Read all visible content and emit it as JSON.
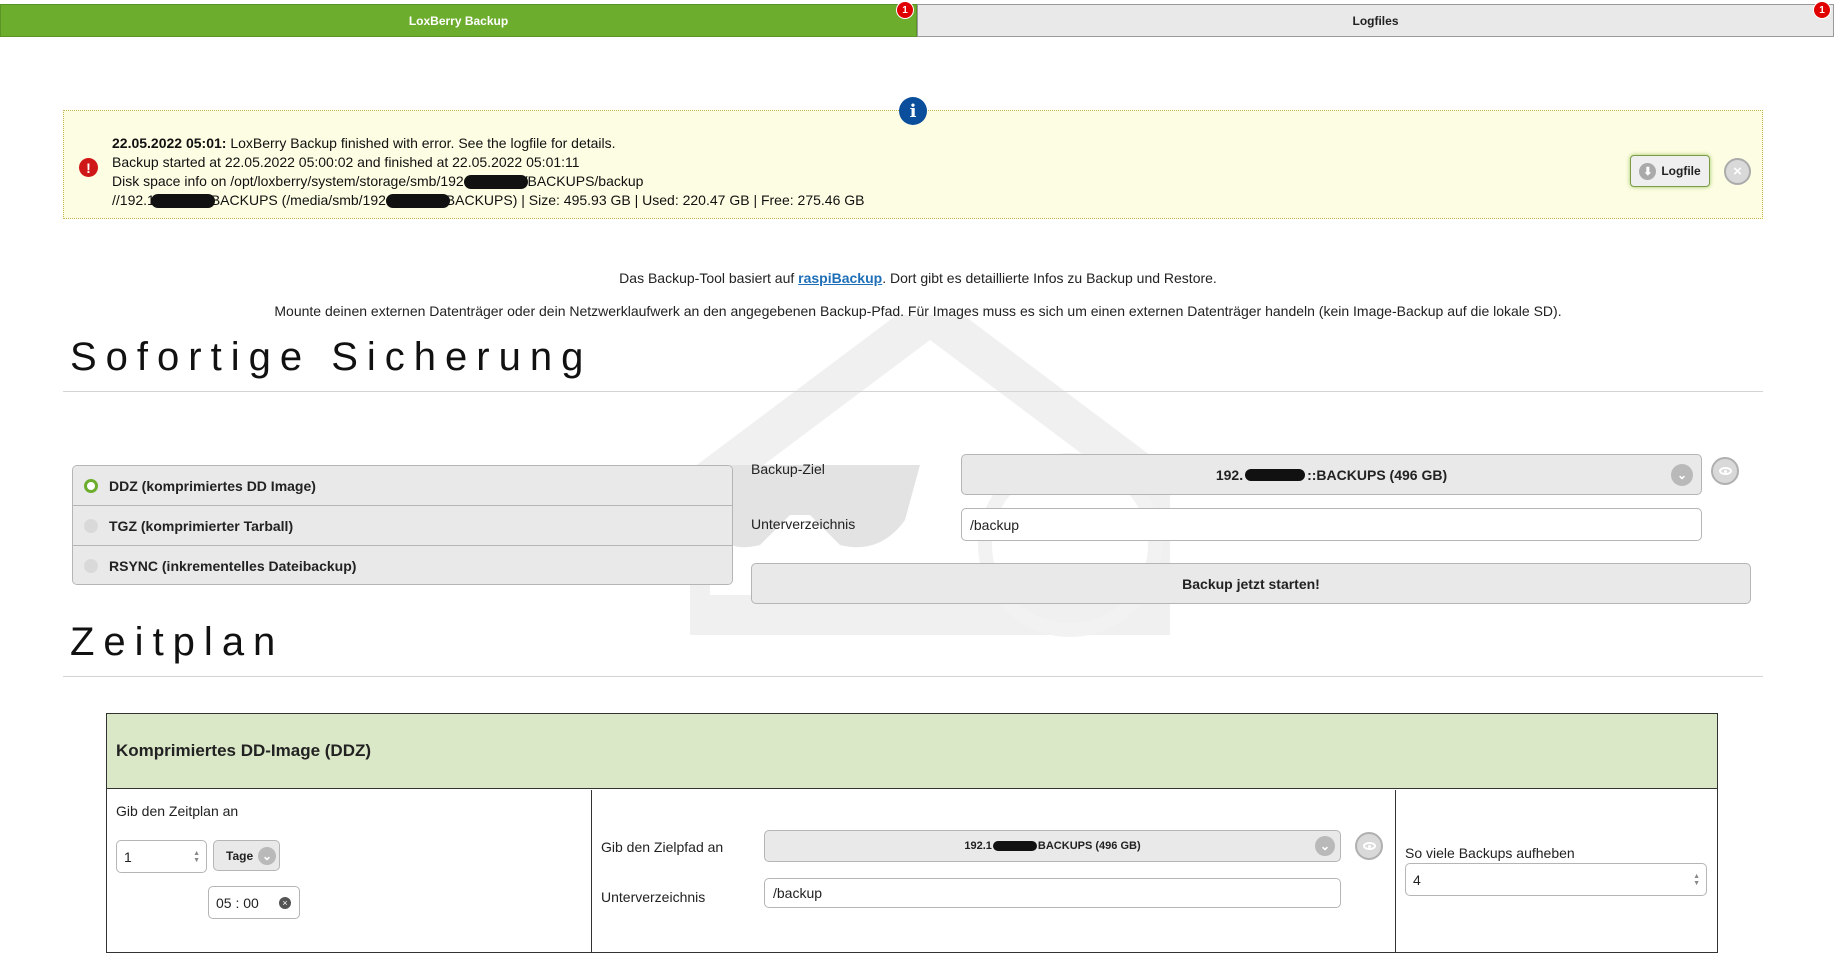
{
  "tabs": [
    {
      "label": "LoxBerry Backup",
      "badge": "1",
      "active": true
    },
    {
      "label": "Logfiles",
      "badge": "1",
      "active": false
    }
  ],
  "notice": {
    "info_icon": "i",
    "error_icon": "!",
    "line1_bold": "22.05.2022 05:01:",
    "line1_text": " LoxBerry Backup finished with error. See the logfile for details.",
    "line2": "Backup started at 22.05.2022 05:00:02 and finished at 22.05.2022 05:01:11",
    "line3a": "Disk space info on /opt/loxberry/system/storage/smb/192.",
    "line3b": "/BACKUPS/backup",
    "line4a": "//192.1",
    "line4b": "BACKUPS (/media/smb/192.",
    "line4c": "BACKUPS) | Size: 495.93 GB | Used: 220.47 GB | Free: 275.46 GB",
    "logfile_button": "Logfile",
    "close_icon": "×"
  },
  "intro": {
    "text1_before": "Das Backup-Tool basiert auf ",
    "text1_link": "raspiBackup",
    "text1_after": ". Dort gibt es detaillierte Infos zu Backup und Restore.",
    "text2": "Mounte deinen externen Datenträger oder dein Netzwerklaufwerk an den angegebenen Backup-Pfad. Für Images muss es sich um einen externen Datenträger handeln (kein Image-Backup auf die lokale SD)."
  },
  "instant": {
    "heading": "Sofortige Sicherung",
    "options": [
      {
        "label": "DDZ (komprimiertes DD Image)",
        "selected": true
      },
      {
        "label": "TGZ (komprimierter Tarball)",
        "selected": false
      },
      {
        "label": "RSYNC (inkrementelles Dateibackup)",
        "selected": false
      }
    ],
    "target_label": "Backup-Ziel",
    "target_value_a": "192.",
    "target_value_b": "::BACKUPS (496 GB)",
    "subdir_label": "Unterverzeichnis",
    "subdir_value": "/backup",
    "start_button": "Backup jetzt starten!"
  },
  "schedule": {
    "heading": "Zeitplan",
    "table_title": "Komprimiertes DD-Image (DDZ)",
    "plan_label": "Gib den Zeitplan an",
    "interval_value": "1",
    "unit_value": "Tage",
    "time_value": "05 : 00",
    "dest_label": "Gib den Zielpfad an",
    "dest_value_a": "192.1",
    "dest_value_b": "BACKUPS (496 GB)",
    "subdir_label": "Unterverzeichnis",
    "subdir_value": "/backup",
    "keep_label": "So viele Backups aufheben",
    "keep_value": "4"
  }
}
